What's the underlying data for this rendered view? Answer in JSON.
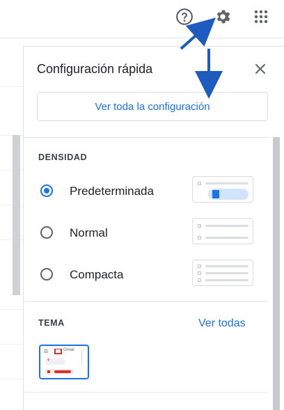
{
  "colors": {
    "accent": "#1a73e8",
    "annotation_arrow": "#1e5bbf"
  },
  "topbar": {
    "icons": [
      "help-icon",
      "gear-icon",
      "apps-grid-icon"
    ]
  },
  "quick_settings": {
    "title": "Configuración rápida",
    "see_all_button": "Ver toda la configuración",
    "density": {
      "label": "DENSIDAD",
      "options": [
        {
          "label": "Predeterminada",
          "checked": true
        },
        {
          "label": "Normal",
          "checked": false
        },
        {
          "label": "Compacta",
          "checked": false
        }
      ]
    },
    "theme": {
      "label": "TEMA",
      "see_all_link": "Ver todas",
      "thumb_text": "Gmail"
    }
  }
}
